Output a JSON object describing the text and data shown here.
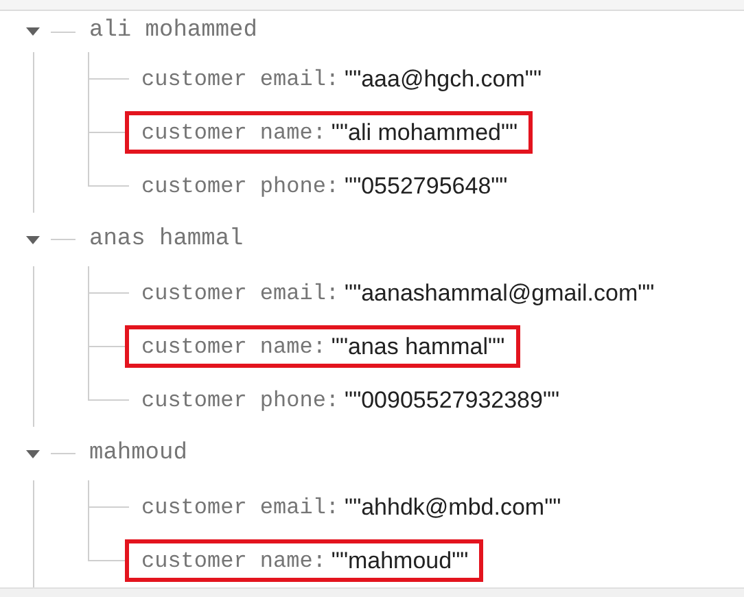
{
  "tree": [
    {
      "label": "ali mohammed",
      "expanded": true,
      "children": [
        {
          "key": "customer email:",
          "value": "\"\"aaa@hgch.com\"\"",
          "highlighted": false
        },
        {
          "key": "customer name:",
          "value": "\"\"ali mohammed\"\"",
          "highlighted": true
        },
        {
          "key": "customer phone:",
          "value": "\"\"0552795648\"\"",
          "highlighted": false
        }
      ]
    },
    {
      "label": "anas hammal",
      "expanded": true,
      "children": [
        {
          "key": "customer email:",
          "value": "\"\"aanashammal@gmail.com\"\"",
          "highlighted": false
        },
        {
          "key": "customer name:",
          "value": "\"\"anas hammal\"\"",
          "highlighted": true
        },
        {
          "key": "customer phone:",
          "value": "\"\"00905527932389\"\"",
          "highlighted": false
        }
      ]
    },
    {
      "label": "mahmoud",
      "expanded": true,
      "children": [
        {
          "key": "customer email:",
          "value": "\"\"ahhdk@mbd.com\"\"",
          "highlighted": false
        },
        {
          "key": "customer name:",
          "value": "\"\"mahmoud\"\"",
          "highlighted": true
        }
      ]
    }
  ]
}
